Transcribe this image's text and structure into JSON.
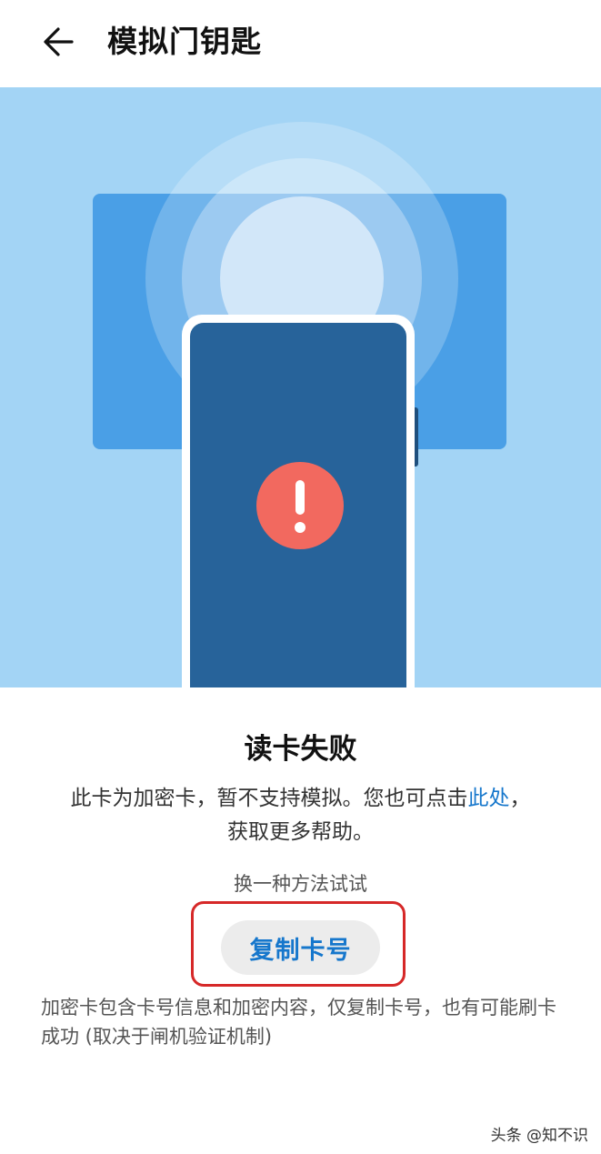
{
  "header": {
    "back_icon": "arrow-left-icon",
    "title": "模拟门钥匙"
  },
  "illustration": {
    "status_icon": "exclamation-icon",
    "colors": {
      "background": "#a3d4f5",
      "card": "#4a9fe6",
      "phone_body": "#27639a",
      "alert": "#f2695f"
    }
  },
  "result": {
    "title": "读卡失败",
    "description_before_link": "此卡为加密卡，暂不支持模拟。您也可点击",
    "description_link": "此处",
    "description_after_link": "，",
    "description_line2": "获取更多帮助。"
  },
  "alternative": {
    "label": "换一种方法试试",
    "copy_button": "复制卡号"
  },
  "note": "加密卡包含卡号信息和加密内容，仅复制卡号，也有可能刷卡成功 (取决于闸机验证机制)",
  "watermark": "头条 @知不识"
}
